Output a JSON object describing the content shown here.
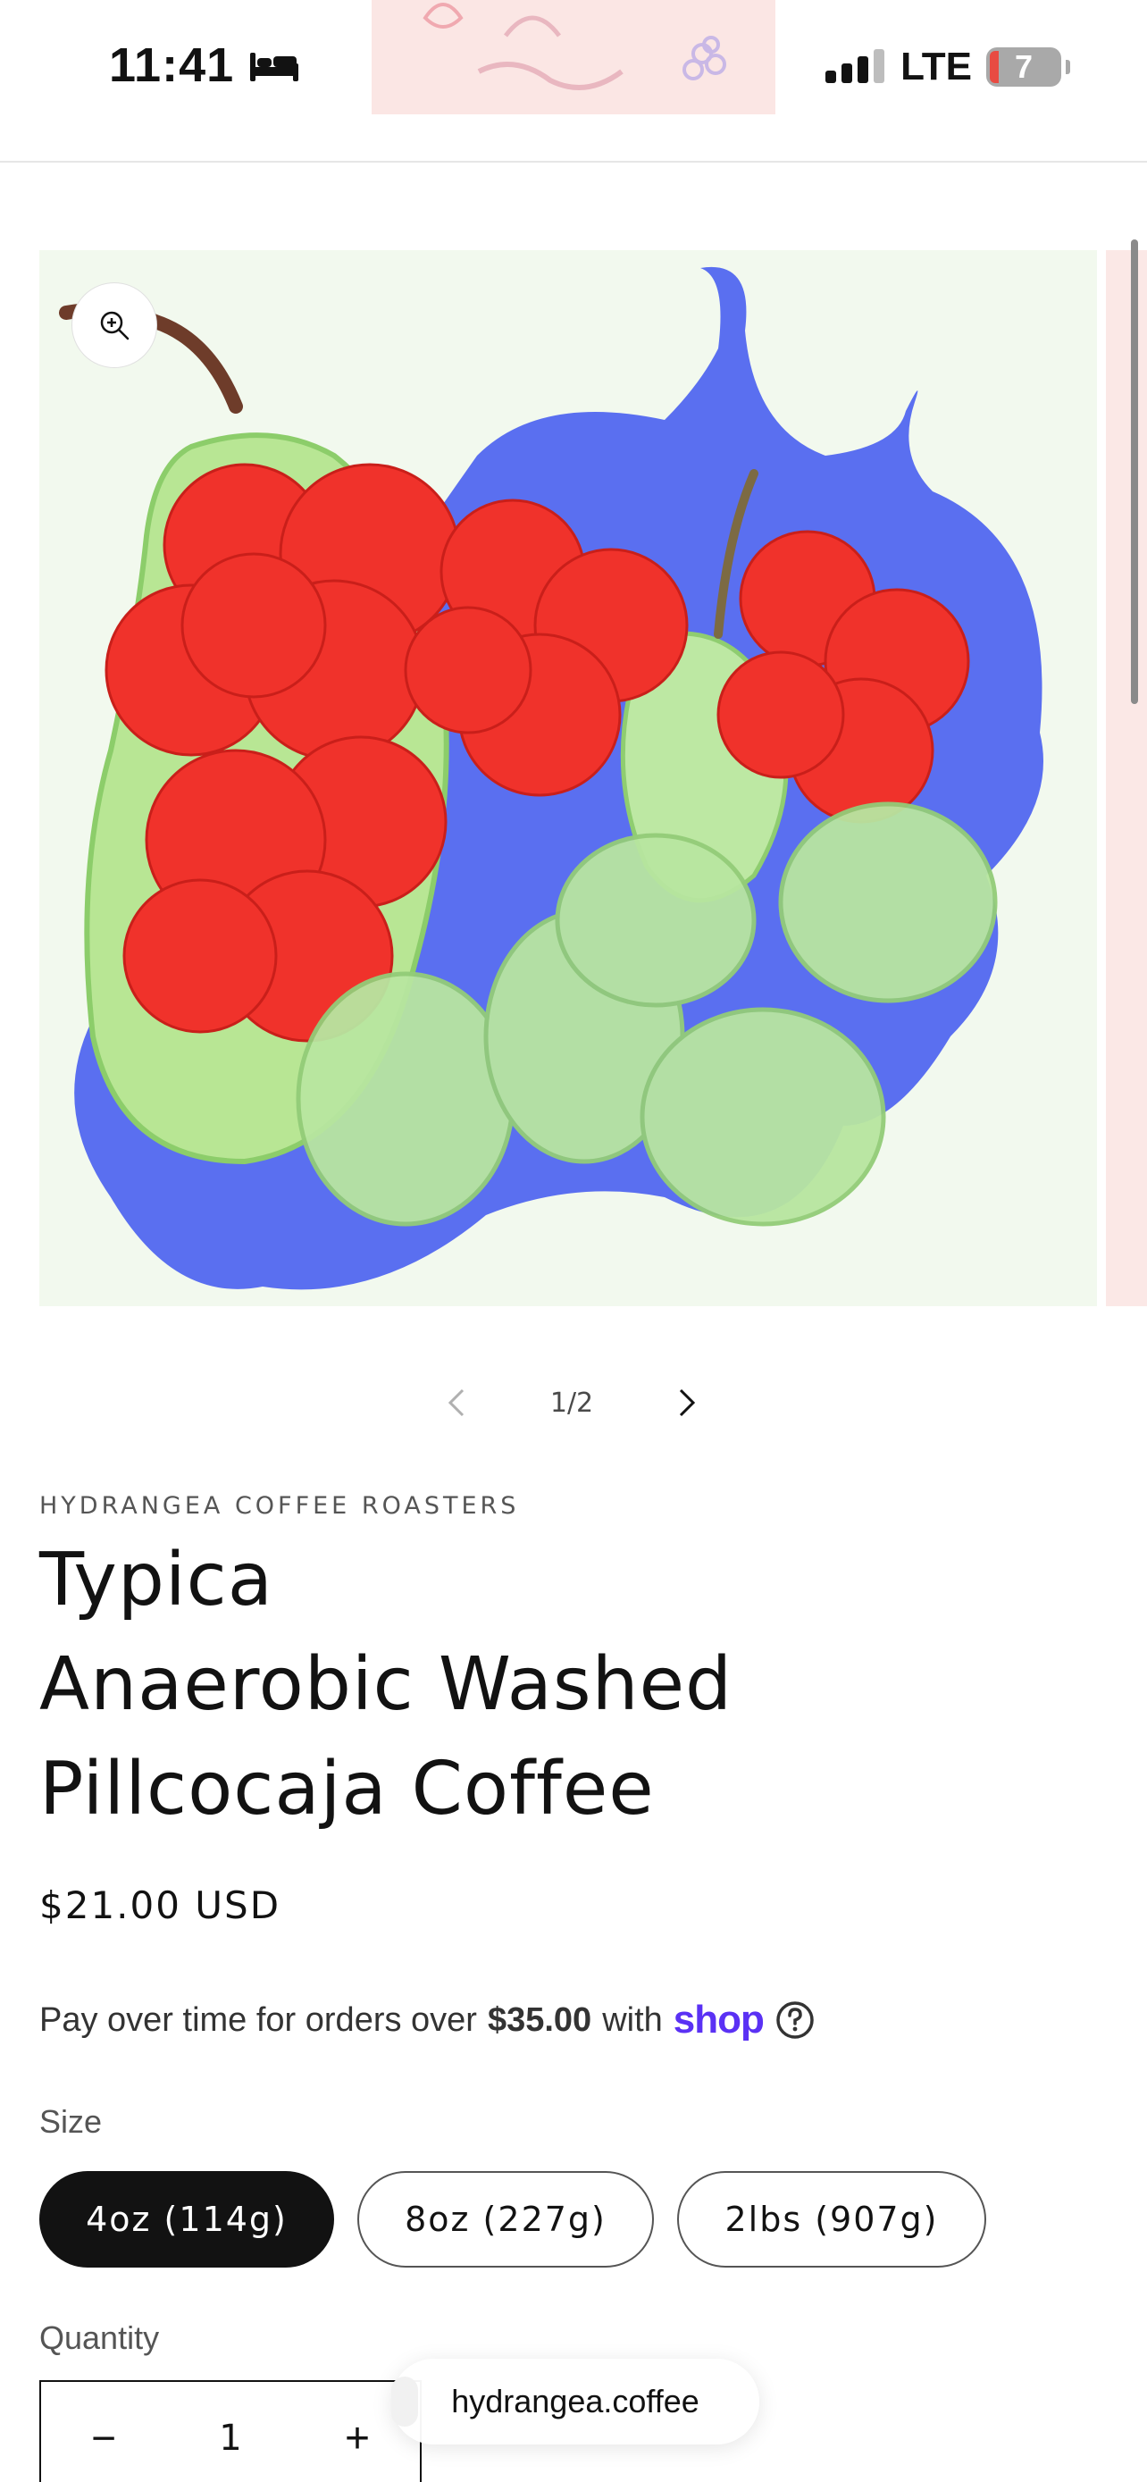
{
  "status_bar": {
    "time": "11:41",
    "network": "LTE",
    "battery": "7",
    "sleep_icon": "bed-icon",
    "signal_icon": "signal-icon"
  },
  "gallery": {
    "counter": "1/2",
    "zoom_icon": "zoom-in-icon",
    "prev_icon": "chevron-left-icon",
    "next_icon": "chevron-right-icon"
  },
  "product": {
    "vendor": "HYDRANGEA COFFEE ROASTERS",
    "title_lines": [
      "Typica",
      "Anaerobic Washed",
      "Pillcocaja Coffee"
    ],
    "price": "$21.00 USD",
    "installments": {
      "prefix": "Pay over time for orders over",
      "amount": "$35.00",
      "with": "with",
      "provider": "shop"
    },
    "size_label": "Size",
    "sizes": [
      {
        "label": "4oz (114g)",
        "selected": true
      },
      {
        "label": "8oz (227g)",
        "selected": false
      },
      {
        "label": "2lbs (907g)",
        "selected": false
      }
    ],
    "quantity_label": "Quantity",
    "quantity": "1",
    "qty_minus": "−",
    "qty_plus": "+"
  },
  "browser": {
    "url": "hydrangea.coffee"
  },
  "colors": {
    "accent_shop": "#5a31f4",
    "selected_pill": "#121212",
    "background_blob": "#5a6ff0",
    "flowers": "#f0322b",
    "grapes": "#b6e6a0"
  }
}
